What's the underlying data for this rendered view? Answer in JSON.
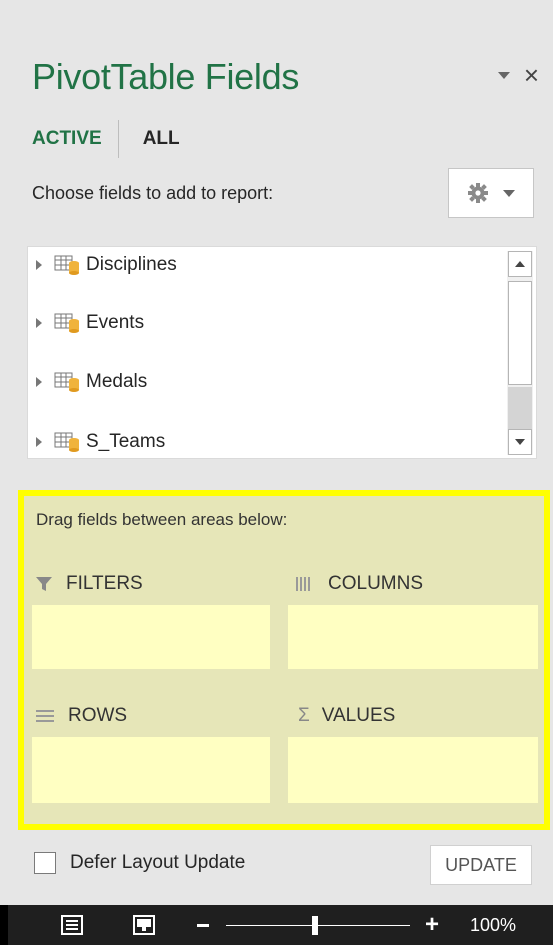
{
  "panel": {
    "title": "PivotTable Fields",
    "close_glyph": "×"
  },
  "tabs": {
    "active": "ACTIVE",
    "all": "ALL"
  },
  "choose_label": "Choose fields to add to report:",
  "fields": [
    {
      "label": "Disciplines",
      "icon": "table-icon"
    },
    {
      "label": "Events",
      "icon": "table-icon"
    },
    {
      "label": "Medals",
      "icon": "table-icon"
    },
    {
      "label": "S_Teams",
      "icon": "table-icon"
    }
  ],
  "areas": {
    "drag_label": "Drag fields between areas below:",
    "filters": "FILTERS",
    "columns": "COLUMNS",
    "rows": "ROWS",
    "values": "VALUES",
    "values_glyph": "Σ"
  },
  "footer": {
    "defer_label": "Defer Layout Update",
    "update_label": "UPDATE"
  },
  "statusbar": {
    "zoom_level": "100%",
    "plus_glyph": "+"
  },
  "colors": {
    "accent": "#217346",
    "highlight": "#ffff00",
    "area_bg": "#e6e6b8",
    "area_box": "#ffffc2"
  }
}
